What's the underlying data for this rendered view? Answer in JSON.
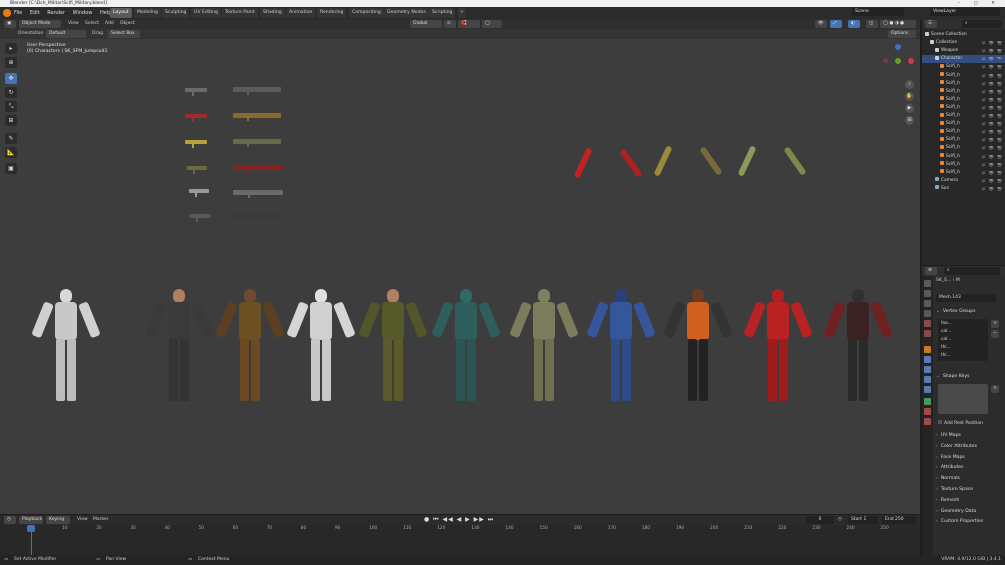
{
  "titlebar": {
    "title": "Blender [C:\\Dch_Militar\\Scifi_Military.blend]",
    "controls": "–  ▢  ✕"
  },
  "menu": {
    "items": [
      "File",
      "Edit",
      "Render",
      "Window",
      "Help"
    ]
  },
  "workspaces": {
    "tabs": [
      "Layout",
      "Modeling",
      "Sculpting",
      "UV Editing",
      "Texture Paint",
      "Shading",
      "Animation",
      "Rendering",
      "Compositing",
      "Geometry Nodes",
      "Scripting"
    ],
    "add": "+",
    "active": "Layout"
  },
  "scene": {
    "scene_label": "Scene",
    "viewlayer_label": "ViewLayer"
  },
  "viewport_header": {
    "mode": "Object Mode",
    "view": "View",
    "select": "Select",
    "add": "Add",
    "object": "Object",
    "transform": "Global",
    "orientation_label": "Orientation",
    "orientation_value": "Default",
    "drag_label": "Drag",
    "drag_value": "Select Box",
    "options": "Options"
  },
  "viewport_overlay": {
    "line1": "User Perspective",
    "line2": "(0) Characters | SK_SFM_Jumpsuit1"
  },
  "tool_icons": [
    "cursor-tool",
    "select-box-tool",
    "move-tool",
    "rotate-tool",
    "scale-tool",
    "transform-tool",
    "annotate-tool",
    "measure-tool",
    "add-cube-tool"
  ],
  "nav_icons": [
    "zoom-icon",
    "pan-icon",
    "camera-icon",
    "grid-icon"
  ],
  "weapon_colors": [
    "#6a6a6a",
    "#a52a2a",
    "#b8a23a",
    "#6b6a3a",
    "#9a9a9a",
    "#5a5a5a"
  ],
  "weapon_colors_right": [
    "#5c5c5c",
    "#8a6a2a",
    "#6a6a4a",
    "#8a2020",
    "#6a6a6a",
    "#3a3a3a"
  ],
  "arm_colors": [
    "#c42222",
    "#b02020",
    "#9a8a3a",
    "#7a6a3a",
    "#8a9a5a",
    "#7a8a4a"
  ],
  "characters": [
    {
      "head": "#d8d8d8",
      "body": "#c8c8c8",
      "legs": "#bdbdbd",
      "arms": "#d0d0d0"
    },
    {
      "head": "#b08060",
      "body": "#3a3a3a",
      "legs": "#333",
      "arms": "#3a3a3a"
    },
    {
      "head": "#704a30",
      "body": "#6b5024",
      "legs": "#6b4a22",
      "arms": "#5a4020"
    },
    {
      "head": "#e0e0e0",
      "body": "#d0d0d0",
      "legs": "#c8c8c8",
      "arms": "#d5d5d5"
    },
    {
      "head": "#b08060",
      "body": "#565a28",
      "legs": "#5a5a2a",
      "arms": "#525628"
    },
    {
      "head": "#2f6a66",
      "body": "#2f5f5c",
      "legs": "#2a5553",
      "arms": "#2f5f5c"
    },
    {
      "head": "#7a8060",
      "body": "#7a7c5c",
      "legs": "#6e7050",
      "arms": "#7a7c5c"
    },
    {
      "head": "#2c3f78",
      "body": "#35569a",
      "legs": "#2f4c8a",
      "arms": "#35569a"
    },
    {
      "head": "#6a3c22",
      "body": "#d06020",
      "legs": "#222",
      "arms": "#333"
    },
    {
      "head": "#b02020",
      "body": "#b82222",
      "legs": "#a01c1c",
      "arms": "#b82222"
    },
    {
      "head": "#303030",
      "body": "#3a2222",
      "legs": "#2a2a2a",
      "arms": "#702020"
    }
  ],
  "timeline_header": {
    "playback": "Playback",
    "keying": "Keying",
    "view": "View",
    "marker": "Marker",
    "current_frame": "0",
    "start_label": "Start",
    "start": "1",
    "end_label": "End",
    "end": "250"
  },
  "timeline": {
    "ticks": [
      "0",
      "10",
      "20",
      "30",
      "40",
      "50",
      "60",
      "70",
      "80",
      "90",
      "100",
      "110",
      "120",
      "130",
      "140",
      "150",
      "160",
      "170",
      "180",
      "190",
      "200",
      "210",
      "220",
      "230",
      "240",
      "250"
    ]
  },
  "statusbar": {
    "left": "Set Active Modifier",
    "mid": "Pan View",
    "ctx": "Context Menu",
    "version": "VRAM: 4.9/12.0 GiB | 3.4.1"
  },
  "outliner": {
    "title": "Scene Collection",
    "rows": [
      {
        "label": "Scene Collection",
        "indent": 0,
        "color": "#cfcfcf"
      },
      {
        "label": "Collection",
        "indent": 1,
        "color": "#cfcfcf"
      },
      {
        "label": "Weapon",
        "indent": 2,
        "color": "#cfcfcf"
      },
      {
        "label": "Character",
        "indent": 2,
        "color": "#cfcfcf"
      },
      {
        "label": "Scifi_h",
        "indent": 3,
        "color": "#e08a3a"
      },
      {
        "label": "Scifi_h",
        "indent": 3,
        "color": "#e08a3a"
      },
      {
        "label": "Scifi_h",
        "indent": 3,
        "color": "#e08a3a"
      },
      {
        "label": "Scifi_h",
        "indent": 3,
        "color": "#e08a3a"
      },
      {
        "label": "Scifi_h",
        "indent": 3,
        "color": "#e08a3a"
      },
      {
        "label": "Scifi_h",
        "indent": 3,
        "color": "#e08a3a"
      },
      {
        "label": "Scifi_h",
        "indent": 3,
        "color": "#e08a3a"
      },
      {
        "label": "Scifi_h",
        "indent": 3,
        "color": "#e08a3a"
      },
      {
        "label": "Scifi_h",
        "indent": 3,
        "color": "#e08a3a"
      },
      {
        "label": "Scifi_h",
        "indent": 3,
        "color": "#e08a3a"
      },
      {
        "label": "Scifi_h",
        "indent": 3,
        "color": "#e08a3a"
      },
      {
        "label": "Scifi_h",
        "indent": 3,
        "color": "#e08a3a"
      },
      {
        "label": "Scifi_h",
        "indent": 3,
        "color": "#e08a3a"
      },
      {
        "label": "Scifi_h",
        "indent": 3,
        "color": "#e08a3a"
      },
      {
        "label": "Camera",
        "indent": 2,
        "color": "#8ab"
      },
      {
        "label": "Sun",
        "indent": 2,
        "color": "#8ab"
      }
    ]
  },
  "properties": {
    "breadcrumb": "SK_S... ›",
    "object": "M",
    "mesh_name": "Mesh.143",
    "vertex_groups_label": "Vertex Groups",
    "vertex_groups": [
      "foo...",
      "cal...",
      "cal...",
      "thi...",
      "thi..."
    ],
    "shape_keys_label": "Shape Keys",
    "add_rest": "Add Rest Position",
    "sections": [
      "UV Maps",
      "Color Attributes",
      "Face Maps",
      "Attributes",
      "Normals",
      "Texture Space",
      "Remesh",
      "Geometry Data",
      "Custom Properties"
    ]
  }
}
